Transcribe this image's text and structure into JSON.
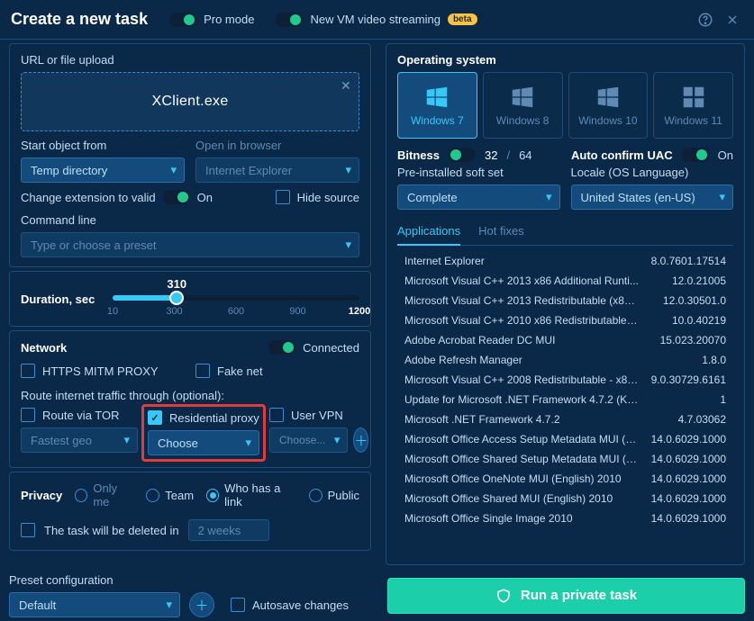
{
  "header": {
    "title": "Create a new task",
    "pro_mode_label": "Pro mode",
    "video_label": "New VM video streaming",
    "beta_badge": "beta"
  },
  "upload": {
    "section_label": "URL or file upload",
    "filename": "XClient.exe"
  },
  "start_object": {
    "label": "Start object from",
    "value": "Temp directory"
  },
  "open_browser": {
    "label": "Open in browser",
    "value": "Internet Explorer"
  },
  "change_ext": {
    "label": "Change extension to valid",
    "state_label": "On"
  },
  "hide_source_label": "Hide source",
  "cmdline": {
    "label": "Command line",
    "placeholder": "Type or choose a preset"
  },
  "duration": {
    "label": "Duration, sec",
    "value": "310",
    "ticks": {
      "t10": "10",
      "t300": "300",
      "t600": "600",
      "t900": "900",
      "t1200": "1200"
    }
  },
  "network": {
    "label": "Network",
    "state": "Connected",
    "https_mitm": "HTTPS MITM PROXY",
    "fakenet": "Fake net",
    "route_label": "Route internet traffic through (optional):",
    "tor": "Route via TOR",
    "tor_geo": "Fastest geo",
    "residential": "Residential proxy",
    "residential_value": "Choose",
    "uservpn_label": "User VPN",
    "uservpn_value": "Choose..."
  },
  "privacy": {
    "label": "Privacy",
    "only_me": "Only me",
    "team": "Team",
    "link": "Who has a link",
    "public": "Public",
    "delete_label": "The task will be deleted in",
    "delete_value": "2 weeks"
  },
  "os": {
    "label": "Operating system",
    "win7": "Windows 7",
    "win8": "Windows 8",
    "win10": "Windows 10",
    "win11": "Windows 11"
  },
  "bitness": {
    "label": "Bitness",
    "v32": "32",
    "v64": "64"
  },
  "uac": {
    "label": "Auto confirm UAC",
    "state": "On"
  },
  "softset": {
    "label": "Pre-installed soft set",
    "value": "Complete"
  },
  "locale": {
    "label": "Locale (OS Language)",
    "value": "United States (en-US)"
  },
  "tabs": {
    "applications": "Applications",
    "hotfixes": "Hot fixes"
  },
  "apps": [
    {
      "name": "Internet Explorer",
      "ver": "8.0.7601.17514"
    },
    {
      "name": "Microsoft Visual C++ 2013 x86 Additional Runti...",
      "ver": "12.0.21005"
    },
    {
      "name": "Microsoft Visual C++ 2013 Redistributable (x86)...",
      "ver": "12.0.30501.0"
    },
    {
      "name": "Microsoft Visual C++ 2010 x86 Redistributable - ...",
      "ver": "10.0.40219"
    },
    {
      "name": "Adobe Acrobat Reader DC MUI",
      "ver": "15.023.20070"
    },
    {
      "name": "Adobe Refresh Manager",
      "ver": "1.8.0"
    },
    {
      "name": "Microsoft Visual C++ 2008 Redistributable - x86 ...",
      "ver": "9.0.30729.6161"
    },
    {
      "name": "Update for Microsoft .NET Framework 4.7.2 (KB...",
      "ver": "1"
    },
    {
      "name": "Microsoft .NET Framework 4.7.2",
      "ver": "4.7.03062"
    },
    {
      "name": "Microsoft Office Access Setup Metadata MUI (E...",
      "ver": "14.0.6029.1000"
    },
    {
      "name": "Microsoft Office Shared Setup Metadata MUI (E...",
      "ver": "14.0.6029.1000"
    },
    {
      "name": "Microsoft Office OneNote MUI (English) 2010",
      "ver": "14.0.6029.1000"
    },
    {
      "name": "Microsoft Office Shared MUI (English) 2010",
      "ver": "14.0.6029.1000"
    },
    {
      "name": "Microsoft Office Single Image 2010",
      "ver": "14.0.6029.1000"
    }
  ],
  "footer": {
    "preset_label": "Preset configuration",
    "preset_value": "Default",
    "autosave_label": "Autosave changes",
    "run_label": "Run a private task"
  }
}
